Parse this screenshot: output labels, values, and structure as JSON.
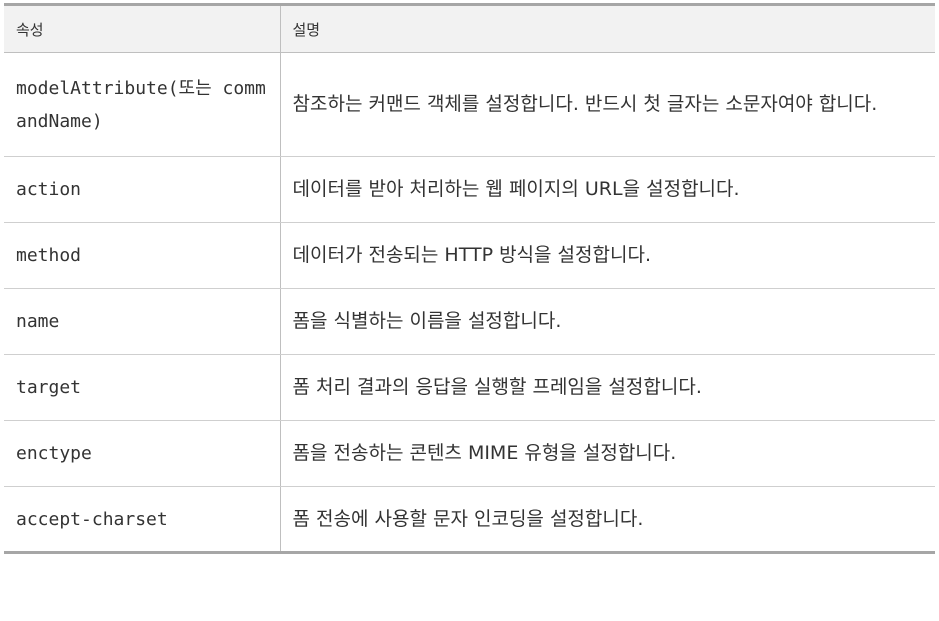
{
  "table": {
    "headers": [
      "속성",
      "설명"
    ],
    "rows": [
      {
        "attribute": "modelAttribute(또는 commandName)",
        "description": "참조하는 커맨드 객체를 설정합니다. 반드시 첫 글자는 소문자여야 합니다."
      },
      {
        "attribute": "action",
        "description": "데이터를 받아 처리하는 웹 페이지의 URL을 설정합니다."
      },
      {
        "attribute": "method",
        "description": "데이터가 전송되는 HTTP 방식을 설정합니다."
      },
      {
        "attribute": "name",
        "description": "폼을 식별하는 이름을 설정합니다."
      },
      {
        "attribute": "target",
        "description": "폼 처리 결과의 응답을 실행할 프레임을 설정합니다."
      },
      {
        "attribute": "enctype",
        "description": "폼을 전송하는 콘텐츠 MIME 유형을 설정합니다."
      },
      {
        "attribute": "accept-charset",
        "description": "폼 전송에 사용할 문자 인코딩을 설정합니다."
      }
    ]
  }
}
